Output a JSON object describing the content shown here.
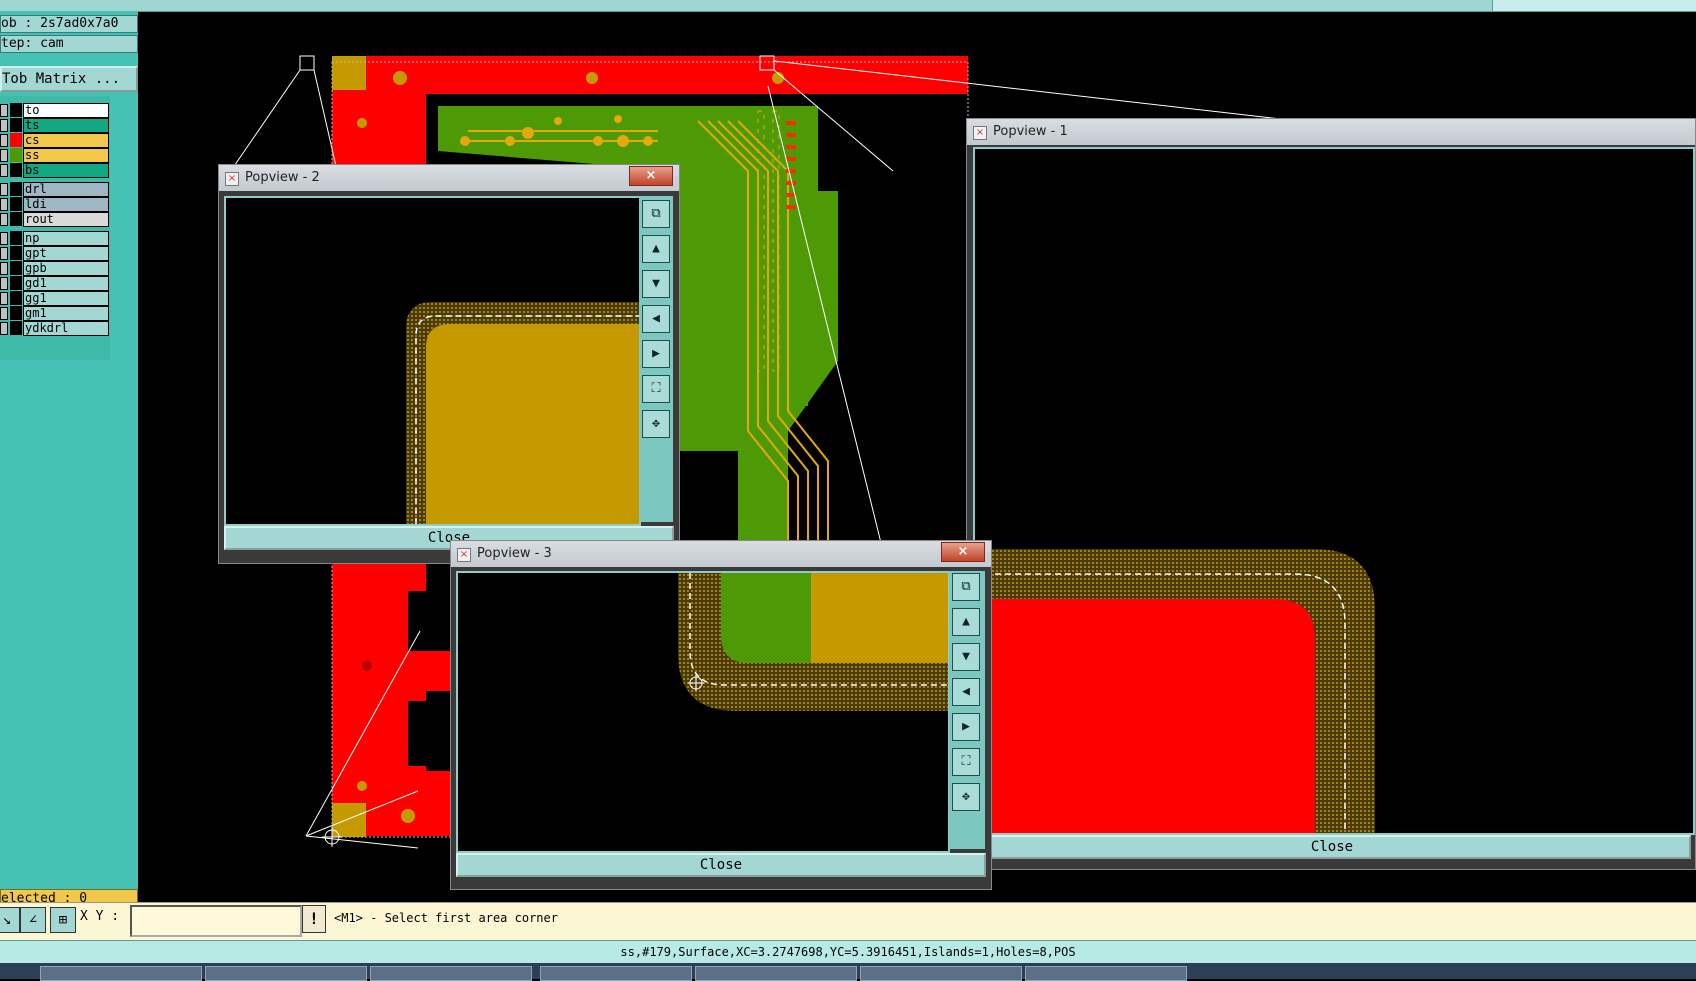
{
  "header": {
    "job": "ob : 2s7ad0x7a0",
    "step": "tep: cam",
    "matrix_button": "Tob Matrix ..."
  },
  "layers": [
    {
      "name": "to",
      "color": "#ffffff",
      "swatch": "#000000"
    },
    {
      "name": "ts",
      "color": "#11a882",
      "swatch": "#000000"
    },
    {
      "name": "cs",
      "color": "#f2c84a",
      "swatch": "#ff0000"
    },
    {
      "name": "ss",
      "color": "#f2c84a",
      "swatch": "#4e9a06"
    },
    {
      "name": "bs",
      "color": "#11a882",
      "swatch": "#000000"
    },
    {
      "name": "drl",
      "color": "#9fb6c4",
      "swatch": "#000000"
    },
    {
      "name": "ldi",
      "color": "#9fb6c4",
      "swatch": "#000000"
    },
    {
      "name": "rout",
      "color": "#d9d9d9",
      "swatch": "#000000"
    },
    {
      "name": "np",
      "color": "#a3d7d3",
      "swatch": "#000000"
    },
    {
      "name": "gpt",
      "color": "#a3d7d3",
      "swatch": "#000000"
    },
    {
      "name": "gpb",
      "color": "#a3d7d3",
      "swatch": "#000000"
    },
    {
      "name": "gd1",
      "color": "#a3d7d3",
      "swatch": "#000000"
    },
    {
      "name": "gg1",
      "color": "#a3d7d3",
      "swatch": "#000000"
    },
    {
      "name": "gm1",
      "color": "#a3d7d3",
      "swatch": "#000000"
    },
    {
      "name": "ydkdrl",
      "color": "#a3d7d3",
      "swatch": "#000000"
    }
  ],
  "selected": "elected : 0",
  "command": {
    "xy_label": "X Y :",
    "xy_value": "",
    "prompt": "<M1> - Select first area corner"
  },
  "status": "ss,#179,Surface,XC=3.2747698,YC=5.3916451,Islands=1,Holes=8,POS",
  "popviews": {
    "p1": {
      "title": "Popview - 1",
      "close": "Close"
    },
    "p2": {
      "title": "Popview - 2",
      "close": "Close"
    },
    "p3": {
      "title": "Popview - 3",
      "close": "Close"
    }
  },
  "colors": {
    "copper_red": "#ff0000",
    "mask_green": "#4e9a06",
    "pad_gold": "#c49a00",
    "panel_teal": "#46c2b4"
  },
  "icons": {
    "close": "close-icon",
    "zoom_window": "zoom-window-icon",
    "pan_up": "pan-up-icon",
    "pan_down": "pan-down-icon",
    "pan_left": "pan-left-icon",
    "pan_right": "pan-right-icon",
    "zoom_fit": "zoom-fit-icon",
    "zoom_home": "zoom-home-icon"
  }
}
